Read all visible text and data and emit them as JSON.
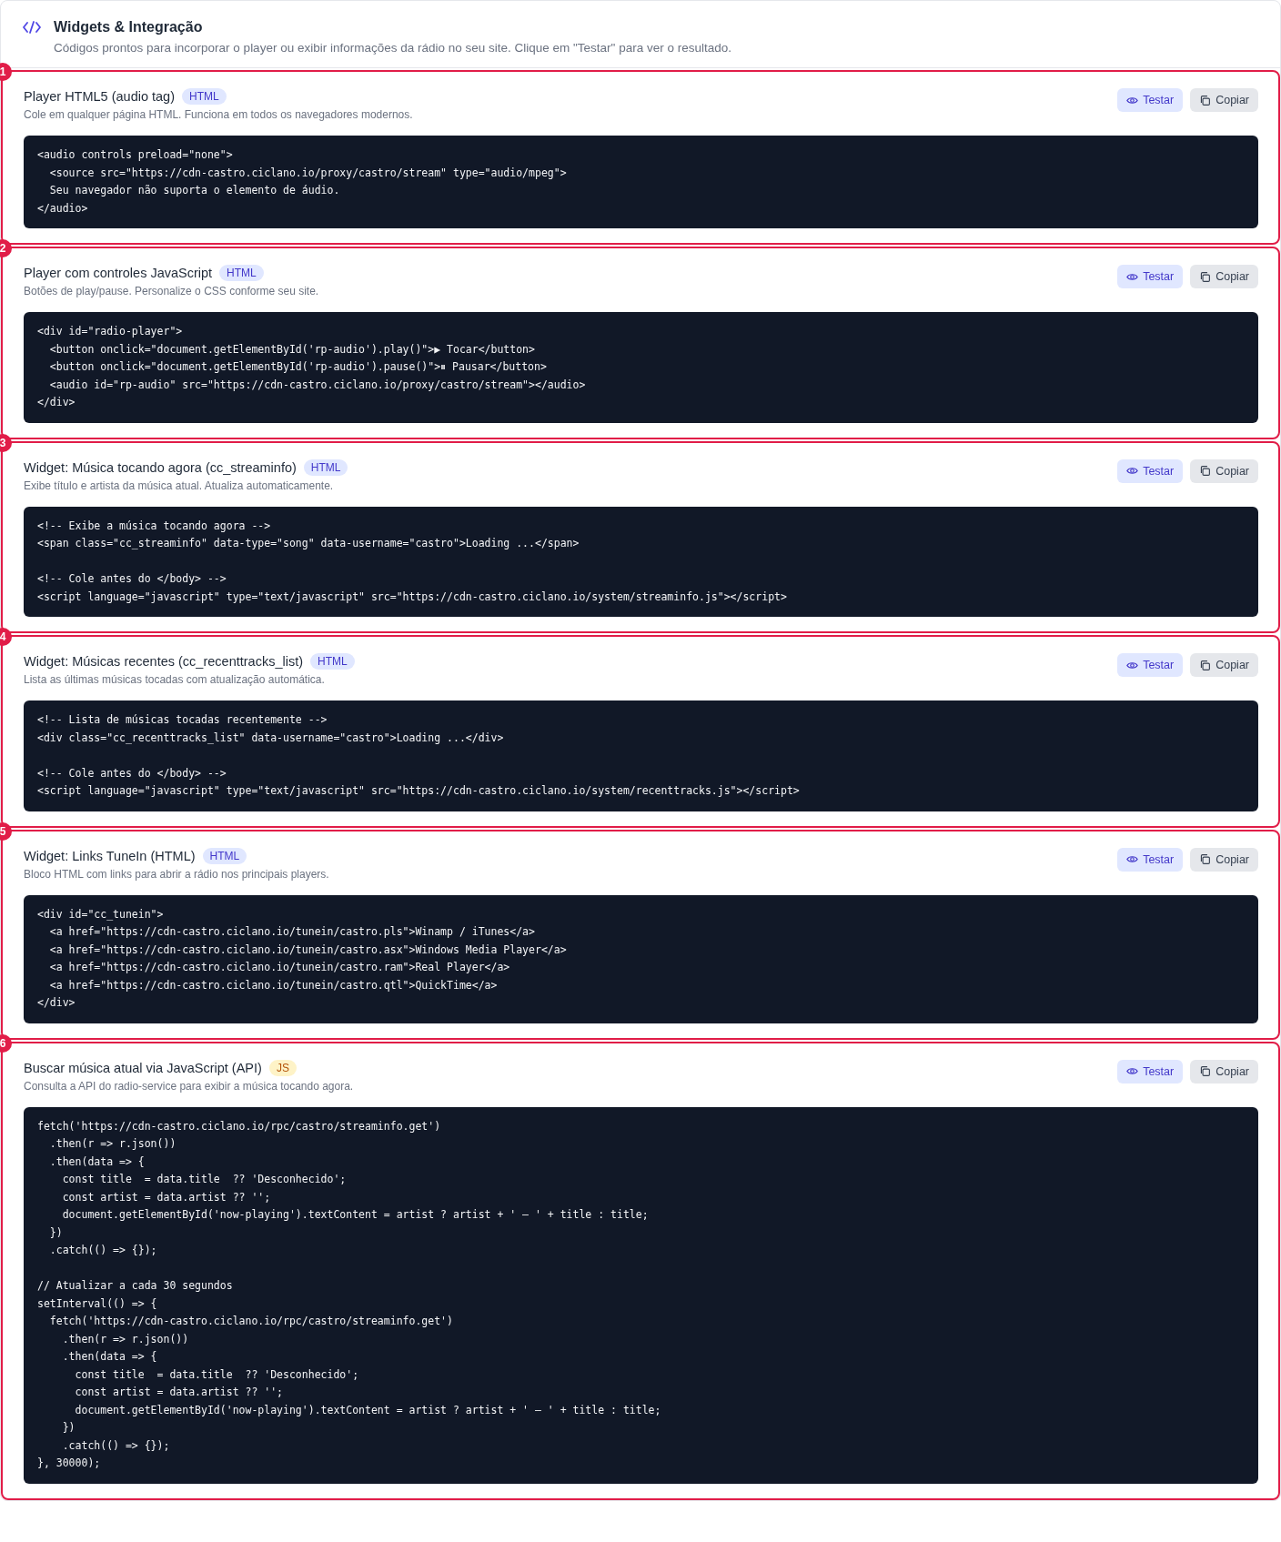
{
  "header": {
    "title": "Widgets & Integração",
    "subtitle": "Códigos prontos para incorporar o player ou exibir informações da rádio no seu site. Clique em \"Testar\" para ver o resultado."
  },
  "widgets": [
    {
      "marker": "1",
      "title": "Player HTML5 (audio tag)",
      "tag": {
        "label": "HTML",
        "kind": "html"
      },
      "description": "Cole em qualquer página HTML. Funciona em todos os navegadores modernos.",
      "actions": [
        {
          "label": "Testar",
          "kind": "test"
        },
        {
          "label": "Copiar",
          "kind": "copy"
        }
      ],
      "code": "<audio controls preload=\"none\">\n  <source src=\"https://cdn-castro.ciclano.io/proxy/castro/stream\" type=\"audio/mpeg\">\n  Seu navegador não suporta o elemento de áudio.\n</audio>"
    },
    {
      "marker": "2",
      "title": "Player com controles JavaScript",
      "tag": {
        "label": "HTML",
        "kind": "html"
      },
      "description": "Botões de play/pause. Personalize o CSS conforme seu site.",
      "actions": [
        {
          "label": "Testar",
          "kind": "test"
        },
        {
          "label": "Copiar",
          "kind": "copy"
        }
      ],
      "code": "<div id=\"radio-player\">\n  <button onclick=\"document.getElementById('rp-audio').play()\">▶ Tocar</button>\n  <button onclick=\"document.getElementById('rp-audio').pause()\">⏸ Pausar</button>\n  <audio id=\"rp-audio\" src=\"https://cdn-castro.ciclano.io/proxy/castro/stream\"></audio>\n</div>"
    },
    {
      "marker": "3",
      "title": "Widget: Música tocando agora (cc_streaminfo)",
      "tag": {
        "label": "HTML",
        "kind": "html"
      },
      "description": "Exibe título e artista da música atual. Atualiza automaticamente.",
      "actions": [
        {
          "label": "Testar",
          "kind": "test"
        },
        {
          "label": "Copiar",
          "kind": "copy"
        }
      ],
      "code": "<!-- Exibe a música tocando agora -->\n<span class=\"cc_streaminfo\" data-type=\"song\" data-username=\"castro\">Loading ...</span>\n\n<!-- Cole antes do </body> -->\n<script language=\"javascript\" type=\"text/javascript\" src=\"https://cdn-castro.ciclano.io/system/streaminfo.js\"></script>"
    },
    {
      "marker": "4",
      "title": "Widget: Músicas recentes (cc_recenttracks_list)",
      "tag": {
        "label": "HTML",
        "kind": "html"
      },
      "description": "Lista as últimas músicas tocadas com atualização automática.",
      "actions": [
        {
          "label": "Testar",
          "kind": "test"
        },
        {
          "label": "Copiar",
          "kind": "copy"
        }
      ],
      "code": "<!-- Lista de músicas tocadas recentemente -->\n<div class=\"cc_recenttracks_list\" data-username=\"castro\">Loading ...</div>\n\n<!-- Cole antes do </body> -->\n<script language=\"javascript\" type=\"text/javascript\" src=\"https://cdn-castro.ciclano.io/system/recenttracks.js\"></script>"
    },
    {
      "marker": "5",
      "title": "Widget: Links TuneIn (HTML)",
      "tag": {
        "label": "HTML",
        "kind": "html"
      },
      "description": "Bloco HTML com links para abrir a rádio nos principais players.",
      "actions": [
        {
          "label": "Testar",
          "kind": "test"
        },
        {
          "label": "Copiar",
          "kind": "copy"
        }
      ],
      "code": "<div id=\"cc_tunein\">\n  <a href=\"https://cdn-castro.ciclano.io/tunein/castro.pls\">Winamp / iTunes</a>\n  <a href=\"https://cdn-castro.ciclano.io/tunein/castro.asx\">Windows Media Player</a>\n  <a href=\"https://cdn-castro.ciclano.io/tunein/castro.ram\">Real Player</a>\n  <a href=\"https://cdn-castro.ciclano.io/tunein/castro.qtl\">QuickTime</a>\n</div>"
    },
    {
      "marker": "6",
      "title": "Buscar música atual via JavaScript (API)",
      "tag": {
        "label": "JS",
        "kind": "js"
      },
      "description": "Consulta a API do radio-service para exibir a música tocando agora.",
      "actions": [
        {
          "label": "Testar",
          "kind": "test"
        },
        {
          "label": "Copiar",
          "kind": "copy"
        }
      ],
      "code": "fetch('https://cdn-castro.ciclano.io/rpc/castro/streaminfo.get')\n  .then(r => r.json())\n  .then(data => {\n    const title  = data.title  ?? 'Desconhecido';\n    const artist = data.artist ?? '';\n    document.getElementById('now-playing').textContent = artist ? artist + ' — ' + title : title;\n  })\n  .catch(() => {});\n\n// Atualizar a cada 30 segundos\nsetInterval(() => {\n  fetch('https://cdn-castro.ciclano.io/rpc/castro/streaminfo.get')\n    .then(r => r.json())\n    .then(data => {\n      const title  = data.title  ?? 'Desconhecido';\n      const artist = data.artist ?? '';\n      document.getElementById('now-playing').textContent = artist ? artist + ' — ' + title : title;\n    })\n    .catch(() => {});\n}, 30000);"
    }
  ]
}
